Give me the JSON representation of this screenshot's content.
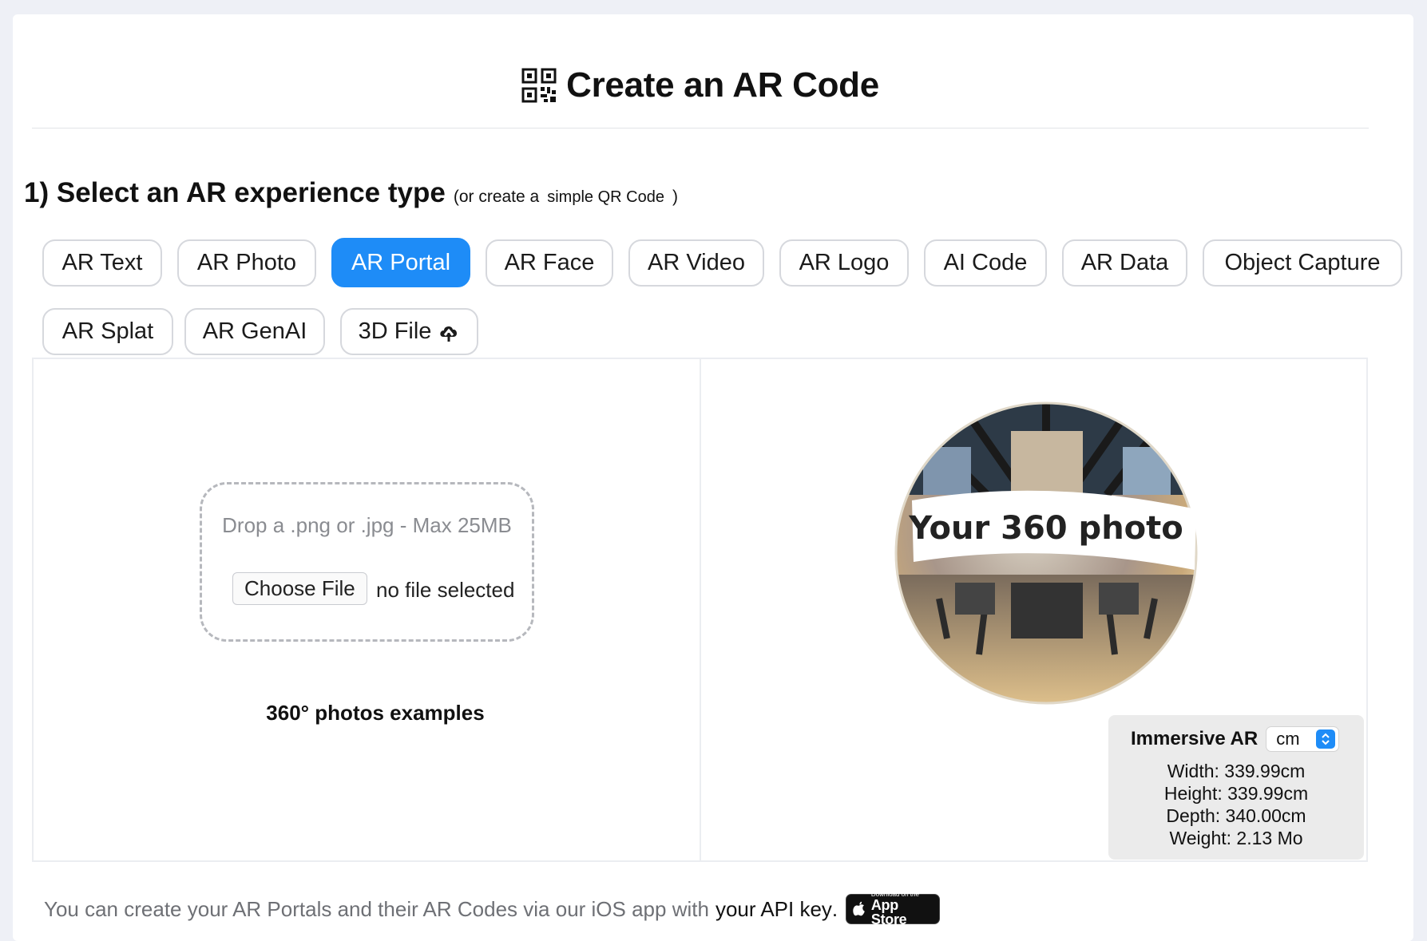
{
  "header": {
    "title": "Create an AR Code",
    "icon": "qr-code-icon"
  },
  "step1": {
    "title": "1) Select an AR experience type",
    "sub_prefix": "(or create a",
    "link": "simple QR Code",
    "sub_suffix": ")"
  },
  "types": {
    "ar_text": "AR Text",
    "ar_photo": "AR Photo",
    "ar_portal": "AR Portal",
    "ar_face": "AR Face",
    "ar_video": "AR Video",
    "ar_logo": "AR Logo",
    "ai_code": "AI Code",
    "ar_data": "AR Data",
    "object_capture": "Object Capture",
    "ar_splat": "AR Splat",
    "ar_genai": "AR GenAI",
    "file_3d": "3D File",
    "selected": "AR Portal"
  },
  "upload": {
    "drop_text": "Drop a .png or .jpg - Max 25MB",
    "choose_label": "Choose File",
    "file_status": "no file selected"
  },
  "examples_label": "360° photos examples",
  "preview": {
    "banner": "Your 360 photo",
    "mode": "Immersive AR",
    "unit": "cm",
    "width": "Width: 339.99cm",
    "height": "Height: 339.99cm",
    "depth": "Depth: 340.00cm",
    "weight": "Weight: 2.13 Mo"
  },
  "footer": {
    "text": "You can create your AR Portals and their AR Codes via our iOS app with",
    "link": "your API key",
    "dot": ".",
    "badge_small": "Download on the",
    "badge_big": "App Store"
  },
  "colors": {
    "accent": "#1e8cf7",
    "border": "#d6d8dd",
    "muted": "#8a8c91"
  }
}
